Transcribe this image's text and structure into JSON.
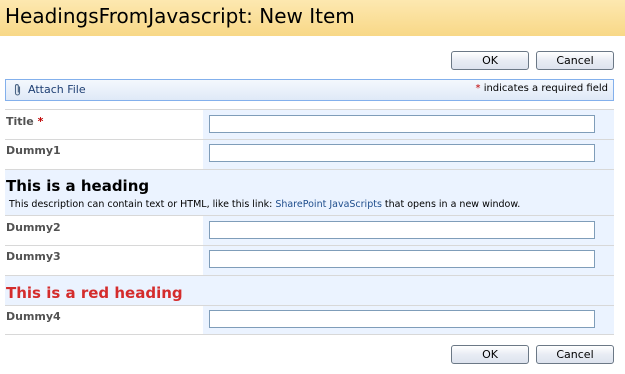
{
  "page": {
    "title": "HeadingsFromJavascript: New Item"
  },
  "buttons": {
    "ok": "OK",
    "cancel": "Cancel"
  },
  "toolbar": {
    "attach_label": "Attach File",
    "required_mark": "*",
    "required_text": " indicates a required field"
  },
  "form": {
    "title_label": "Title",
    "required_star": "*",
    "dummy1": "Dummy1",
    "heading1": "This is a heading",
    "description_prefix": "This description can contain text or HTML, like this link: ",
    "description_link": "SharePoint JavaScripts",
    "description_suffix": " that opens in a new window.",
    "dummy2": "Dummy2",
    "dummy3": "Dummy3",
    "heading2": "This is a red heading",
    "dummy4": "Dummy4"
  },
  "colors": {
    "title_bar": "#f8d887",
    "field_bg": "#ebf3ff",
    "red_heading": "#d42c2c",
    "required": "#bf0000"
  },
  "icons": {
    "attach": "paperclip-icon"
  }
}
